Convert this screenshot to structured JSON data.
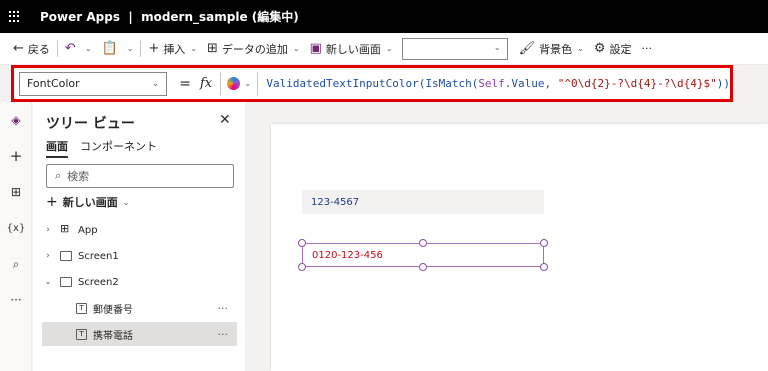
{
  "titlebar": {
    "app": "Power Apps",
    "separator": "|",
    "doc": "modern_sample (編集中)"
  },
  "cmdbar": {
    "back": "戻る",
    "insert": "挿入",
    "add_data": "データの追加",
    "new_screen": "新しい画面",
    "background": "背景色",
    "settings": "設定",
    "more": "···"
  },
  "formula_bar": {
    "property": "FontColor",
    "equals": "=",
    "fx": "fx",
    "formula_parts": {
      "fn1": "ValidatedTextInputColor(",
      "fn2": "IsMatch(",
      "self": "Self",
      "prop": ".Value, ",
      "regex": "\"^0\\d{2}-?\\d{4}-?\\d{4}$\"",
      "close": "))"
    }
  },
  "rail": {
    "icons": [
      "layers-icon",
      "plus-icon",
      "table-icon",
      "variables-icon",
      "search-icon",
      "more-icon"
    ],
    "variables_label": "{x}"
  },
  "tree": {
    "title": "ツリー ビュー",
    "tabs": [
      "画面",
      "コンポーネント"
    ],
    "search_placeholder": "検索",
    "new_screen": "新しい画面",
    "items": [
      {
        "label": "App"
      },
      {
        "label": "Screen1"
      },
      {
        "label": "Screen2"
      },
      {
        "label": "郵便番号"
      },
      {
        "label": "携帯電話"
      }
    ],
    "more": "···"
  },
  "canvas": {
    "input1_value": "123-4567",
    "input2_value": "0120-123-456"
  },
  "colors": {
    "accent": "#742774",
    "error_text": "#c50f1f",
    "highlight": "#e00000"
  }
}
